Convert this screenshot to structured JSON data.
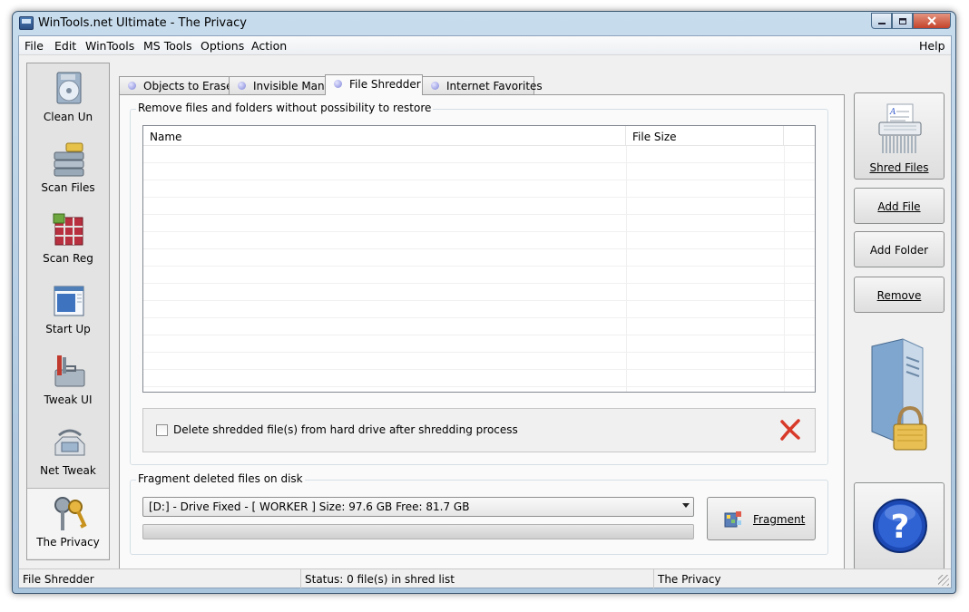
{
  "window": {
    "title": "WinTools.net Ultimate - The Privacy"
  },
  "menu": {
    "items": [
      "File",
      "Edit",
      "WinTools",
      "MS Tools",
      "Options",
      "Action"
    ],
    "help": "Help"
  },
  "sidebar": {
    "items": [
      {
        "label": "Clean Un",
        "icon": "clean-uninstaller-icon"
      },
      {
        "label": "Scan Files",
        "icon": "scan-files-icon"
      },
      {
        "label": "Scan Reg",
        "icon": "scan-registry-icon"
      },
      {
        "label": "Start Up",
        "icon": "startup-window-icon"
      },
      {
        "label": "Tweak UI",
        "icon": "toolbox-icon"
      },
      {
        "label": "Net Tweak",
        "icon": "network-phone-icon"
      },
      {
        "label": "The Privacy",
        "icon": "keys-icon"
      }
    ],
    "active": "The Privacy"
  },
  "tabs": [
    {
      "label": "Objects to Erase"
    },
    {
      "label": "Invisible Man"
    },
    {
      "label": "File Shredder"
    },
    {
      "label": "Internet Favorites"
    }
  ],
  "active_tab": "File Shredder",
  "shredder": {
    "group_title": "Remove files and folders without possibility to restore",
    "columns": [
      "Name",
      "File Size"
    ],
    "rows": [],
    "option_label": "Delete shredded file(s) from hard drive after shredding process",
    "option_checked": false
  },
  "fragment": {
    "group_title": "Fragment deleted files on disk",
    "drive_selected": "[D:] - Drive Fixed - [ WORKER ]  Size: 97.6 GB  Free: 81.7 GB",
    "progress": 0,
    "button_label": "Fragment"
  },
  "actions": {
    "shred": "Shred Files",
    "add_file": "Add File",
    "add_folder": "Add Folder",
    "remove": "Remove"
  },
  "status": {
    "module": "File Shredder",
    "message": "Status: 0 file(s) in shred list",
    "section": "The Privacy"
  },
  "colors": {
    "accent": "#3a5fcd",
    "delete_x": "#d83a2a",
    "titlebar": "#b9d1e6"
  }
}
